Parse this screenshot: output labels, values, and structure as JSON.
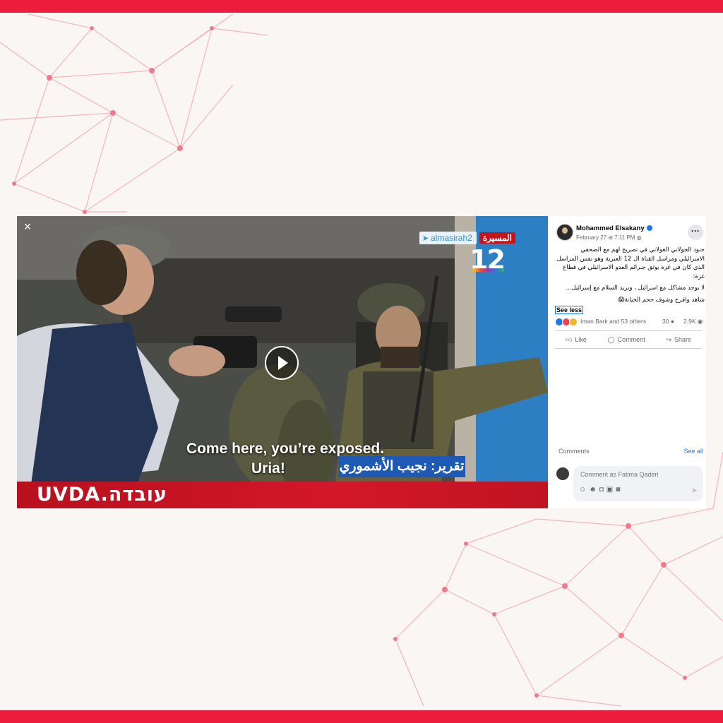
{
  "video": {
    "channel_handle": "almasirah2",
    "channel_name": "المسيرة",
    "channel_number": "12",
    "subtitle_line1": "Come here, you’re exposed.",
    "subtitle_line2": "Uria!",
    "reporter_caption": "تقرير: نجيب الأشموري",
    "ticker_text": "UVDA.עובדה"
  },
  "post": {
    "author": "Mohammed Elsakany",
    "date": "February 27 at 7:11 PM",
    "text_para1": "جنود الجولاني الغولاني في تصريح لهم مع الصحفي الاسرائيلي ومراسل القناة ال 12 العبرية وهو نفس المراسل الذي كان في غزة يوثق جـرائم العدو الاسرائيلي في قطاع غزة:",
    "text_para2": "لا يوجد مشاكل مع اسرائيل ، ونريد السلام مع إسرائيل...",
    "text_para3": "شاهد وافرح وشوف حجم الخيانة😱",
    "see_less": "See less",
    "reactors": "Iman Bark and 53 others",
    "comments_count": "30",
    "shares_count": "2.9K",
    "like": "Like",
    "comment": "Comment",
    "share": "Share",
    "comments_label": "Comments",
    "see_all": "See all",
    "comment_placeholder": "Comment as Fatima Qaderi"
  },
  "colors": {
    "brand_band": "#ec1c3c",
    "facebook_blue": "#1877f2",
    "reporter_bar": "#1d59b5",
    "ticker_red": "#d3172a"
  }
}
